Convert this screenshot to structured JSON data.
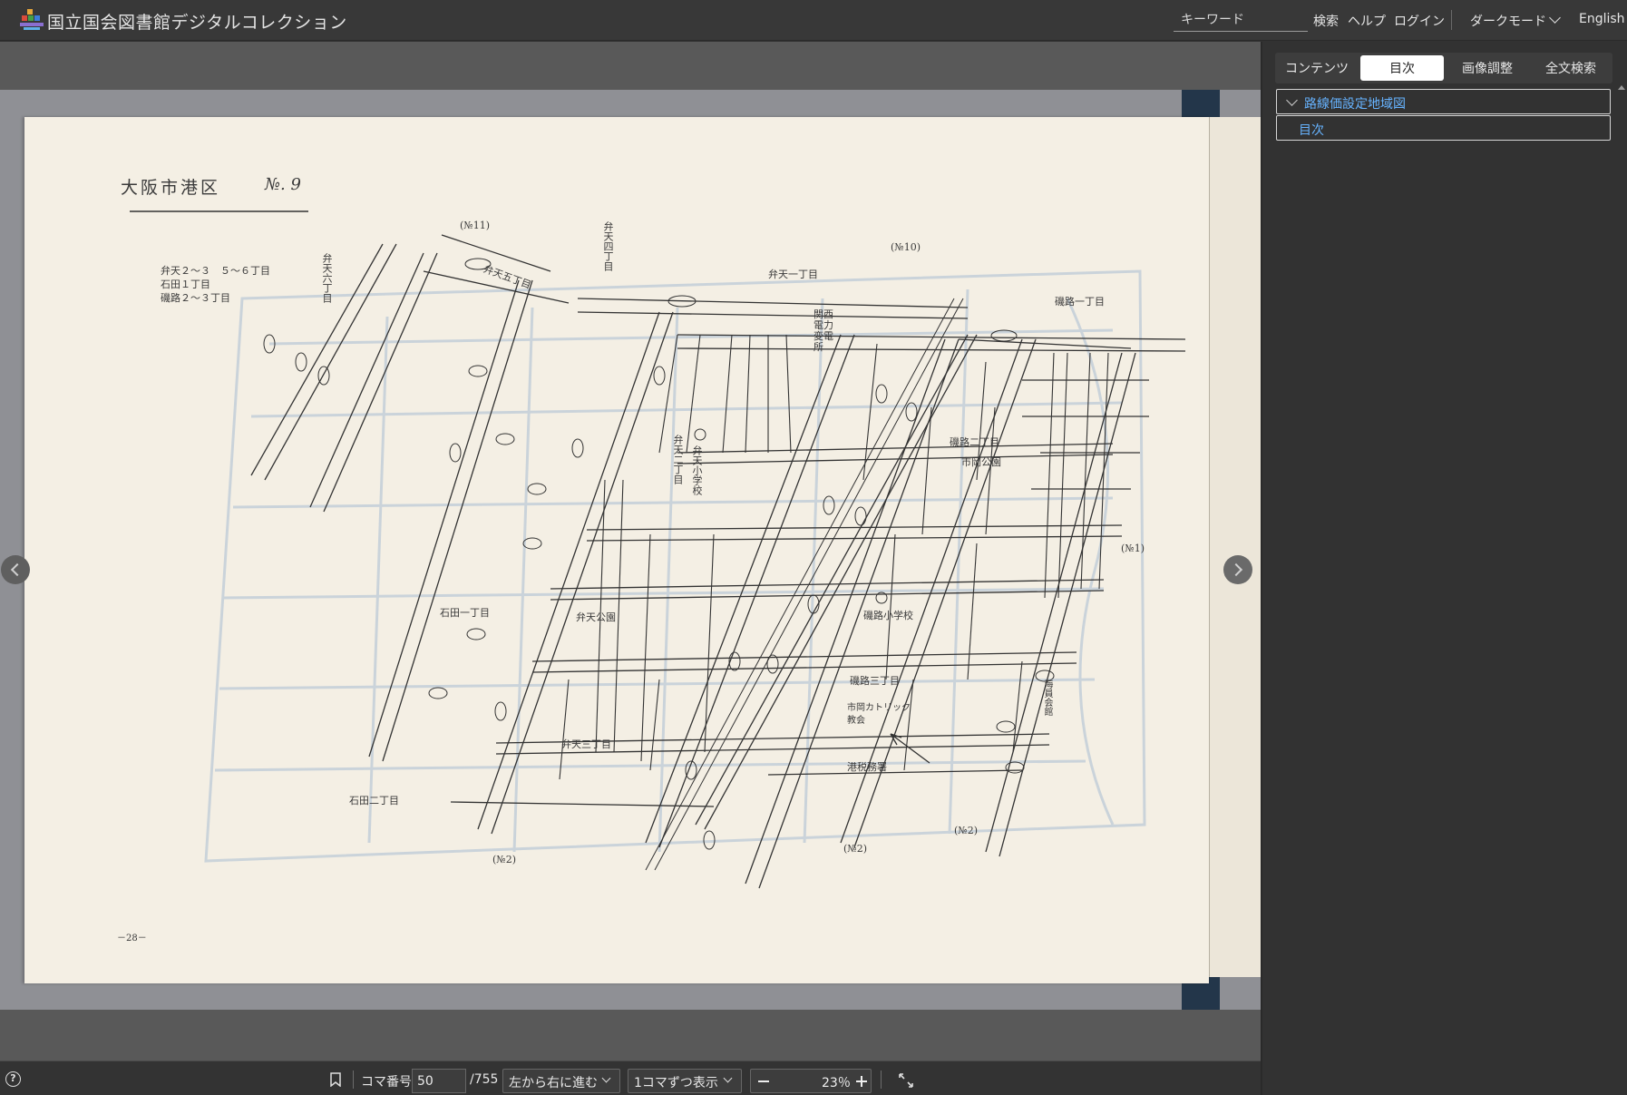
{
  "header": {
    "app_title": "国立国会図書館デジタルコレクション",
    "keyword_placeholder": "キーワード",
    "search": "検索",
    "help": "ヘルプ",
    "login": "ログイン",
    "dark_mode": "ダークモード",
    "language": "English"
  },
  "panel": {
    "tabs": [
      {
        "label": "コンテンツ",
        "active": false
      },
      {
        "label": "目次",
        "active": true
      },
      {
        "label": "画像調整",
        "active": false
      },
      {
        "label": "全文検索",
        "active": false
      }
    ],
    "toc": [
      {
        "label": "路線価設定地域図",
        "expanded": true
      },
      {
        "label": "目次"
      }
    ]
  },
  "toolbar": {
    "frame_label": "コマ番号",
    "frame_value": "50",
    "frame_total": "/755",
    "direction": "左から右に進む",
    "display_mode": "1コマずつ表示",
    "zoom": "23％"
  },
  "map": {
    "title": "大阪市港区",
    "number": "№. 9",
    "legend_lines": [
      "弁天２～３　５～６丁目",
      "石田１丁目",
      "磯路２～３丁目"
    ],
    "areas": [
      "弁天一丁目",
      "弁天五丁目",
      "弁天六丁目",
      "弁天四丁目",
      "弁天二丁目",
      "弁天三丁目",
      "弁天公園",
      "弁天小学校",
      "石田一丁目",
      "石田二丁目",
      "磯路一丁目",
      "磯路二丁目",
      "磯路三丁目",
      "磯路小学校",
      "市岡公園",
      "市岡カトリック教会",
      "港税務署",
      "関西電力変電所",
      "海員会館"
    ],
    "sheet_refs": [
      "(№11)",
      "(№10)",
      "(№1)",
      "(№2)",
      "(№2)",
      "(№2)"
    ],
    "page_number": "－28－"
  }
}
